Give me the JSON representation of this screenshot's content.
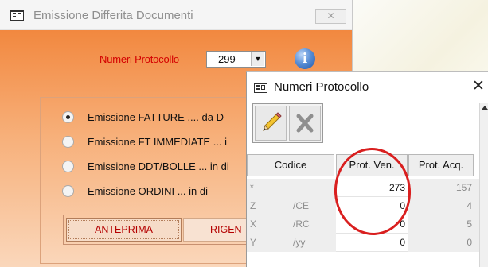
{
  "main_window": {
    "title": "Emissione Differita Documenti",
    "close_glyph": "✕",
    "protocol_link": "Numeri Protocollo",
    "protocol_value": "299",
    "dropdown_glyph": "▼",
    "info_glyph": "i",
    "options": [
      {
        "label": "Emissione FATTURE ....  da D",
        "checked": true
      },
      {
        "label": "Emissione FT IMMEDIATE ... i",
        "checked": false
      },
      {
        "label": "Emissione DDT/BOLLE ... in di",
        "checked": false
      },
      {
        "label": "Emissione ORDINI   ...    in di",
        "checked": false
      }
    ],
    "buttons": {
      "anteprima": "ANTEPRIMA",
      "rigen": "RIGEN"
    }
  },
  "popup": {
    "title": "Numeri Protocollo",
    "close_glyph": "✕",
    "columns": {
      "codice": "Codice",
      "ven": "Prot. Ven.",
      "acq": "Prot. Acq."
    },
    "rows": [
      {
        "a": "*",
        "b": "",
        "ven": "273",
        "acq": "157"
      },
      {
        "a": "Z",
        "b": "/CE",
        "ven": "0",
        "acq": "4"
      },
      {
        "a": "X",
        "b": "/RC",
        "ven": "0",
        "acq": "5"
      },
      {
        "a": "Y",
        "b": "/yy",
        "ven": "0",
        "acq": "0"
      }
    ]
  },
  "colors": {
    "accent_red": "#d40000",
    "annotation_circle": "#d91f1f",
    "orange": "#f2883f"
  },
  "icons": [
    "app-window-icon",
    "info-icon",
    "pencil-icon",
    "delete-x-icon",
    "close-icon",
    "scroll-up-icon"
  ]
}
